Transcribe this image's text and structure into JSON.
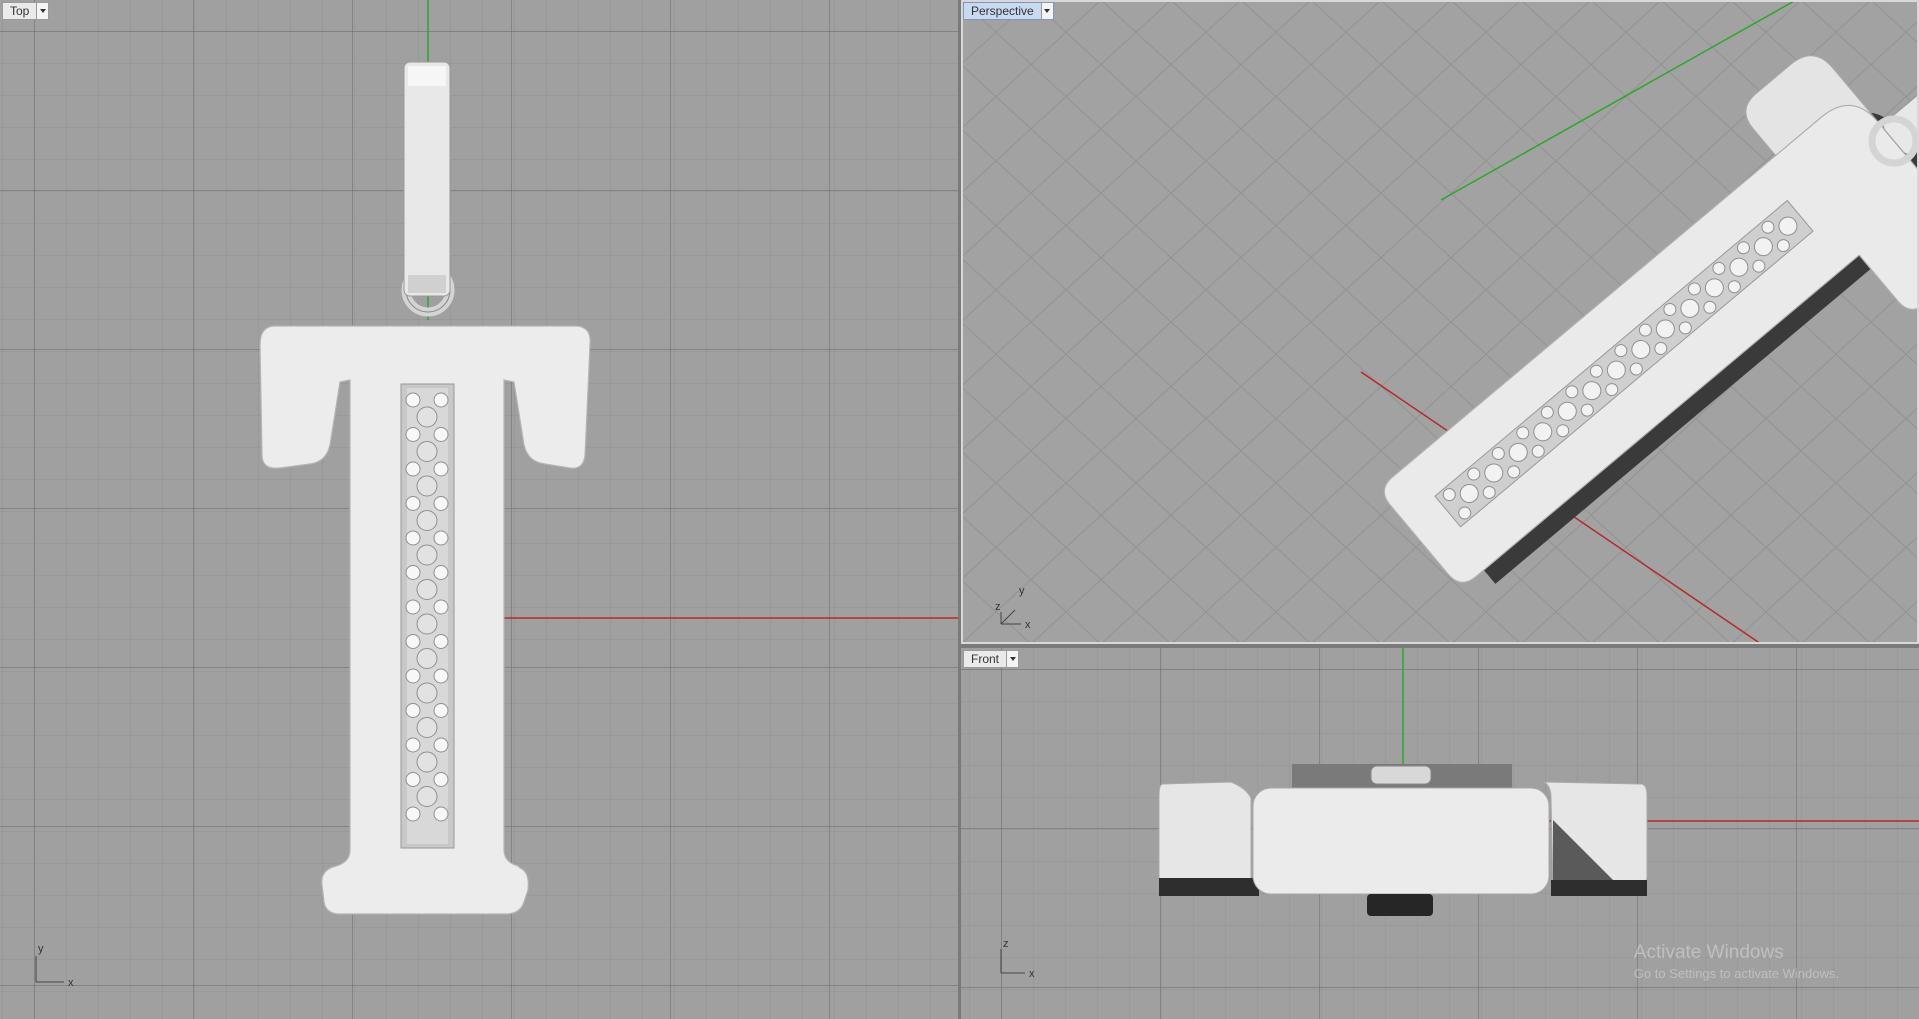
{
  "viewports": {
    "top": {
      "label": "Top",
      "axis_labels": {
        "vertical": "y",
        "horizontal": "x"
      }
    },
    "perspective": {
      "label": "Perspective",
      "axis_labels": {
        "vertical": "y",
        "depth": "z",
        "horizontal": "x"
      }
    },
    "front": {
      "label": "Front",
      "axis_labels": {
        "vertical": "z",
        "horizontal": "x"
      }
    }
  },
  "watermark": {
    "title": "Activate Windows",
    "subtitle": "Go to Settings to activate Windows."
  },
  "colors": {
    "x_axis": "#b52a2a",
    "y_axis": "#2ea52e",
    "viewport_bg": "#a0a0a0",
    "model": "#ececec"
  },
  "icons": [
    "chevron-down-icon",
    "axis-triad-icon"
  ]
}
